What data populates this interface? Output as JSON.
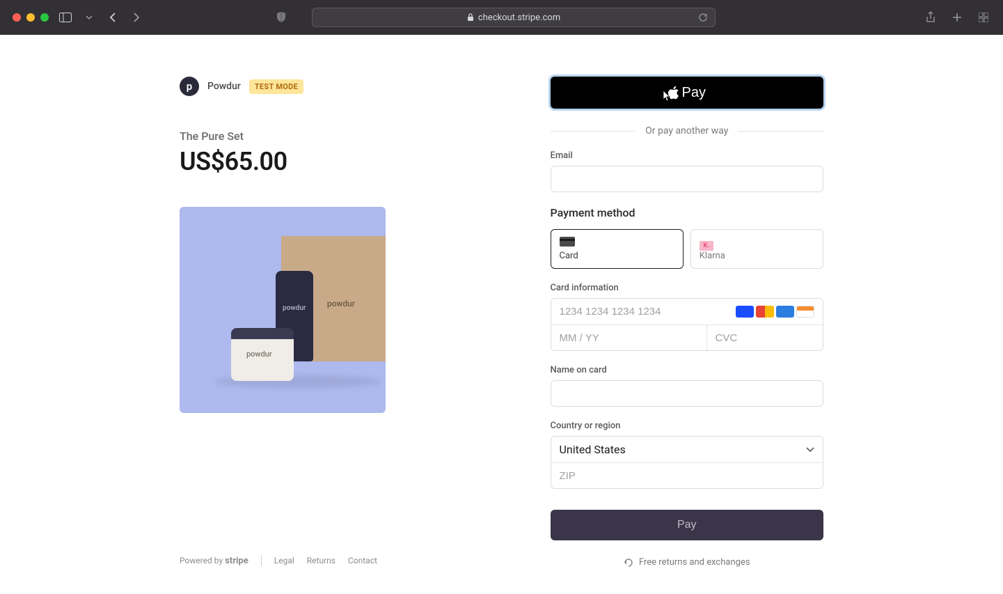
{
  "browser": {
    "url": "checkout.stripe.com"
  },
  "merchant": {
    "logo_letter": "p",
    "name": "Powdur",
    "badge": "TEST MODE"
  },
  "product": {
    "name": "The Pure Set",
    "price": "US$65.00",
    "brand_label": "powdur"
  },
  "footer": {
    "powered_by": "Powered by",
    "stripe": "stripe",
    "links": [
      "Legal",
      "Returns",
      "Contact"
    ]
  },
  "express": {
    "apple_pay_label": "Pay"
  },
  "separator": "Or pay another way",
  "form": {
    "email_label": "Email",
    "payment_method_label": "Payment method",
    "methods": [
      {
        "name": "Card",
        "selected": true
      },
      {
        "name": "Klarna",
        "badge": "K.",
        "selected": false
      }
    ],
    "card_info_label": "Card information",
    "card_number_placeholder": "1234 1234 1234 1234",
    "expiry_placeholder": "MM / YY",
    "cvc_placeholder": "CVC",
    "name_label": "Name on card",
    "country_label": "Country or region",
    "country_value": "United States",
    "zip_placeholder": "ZIP",
    "pay_button": "Pay"
  },
  "policy_text": "Free returns and exchanges"
}
